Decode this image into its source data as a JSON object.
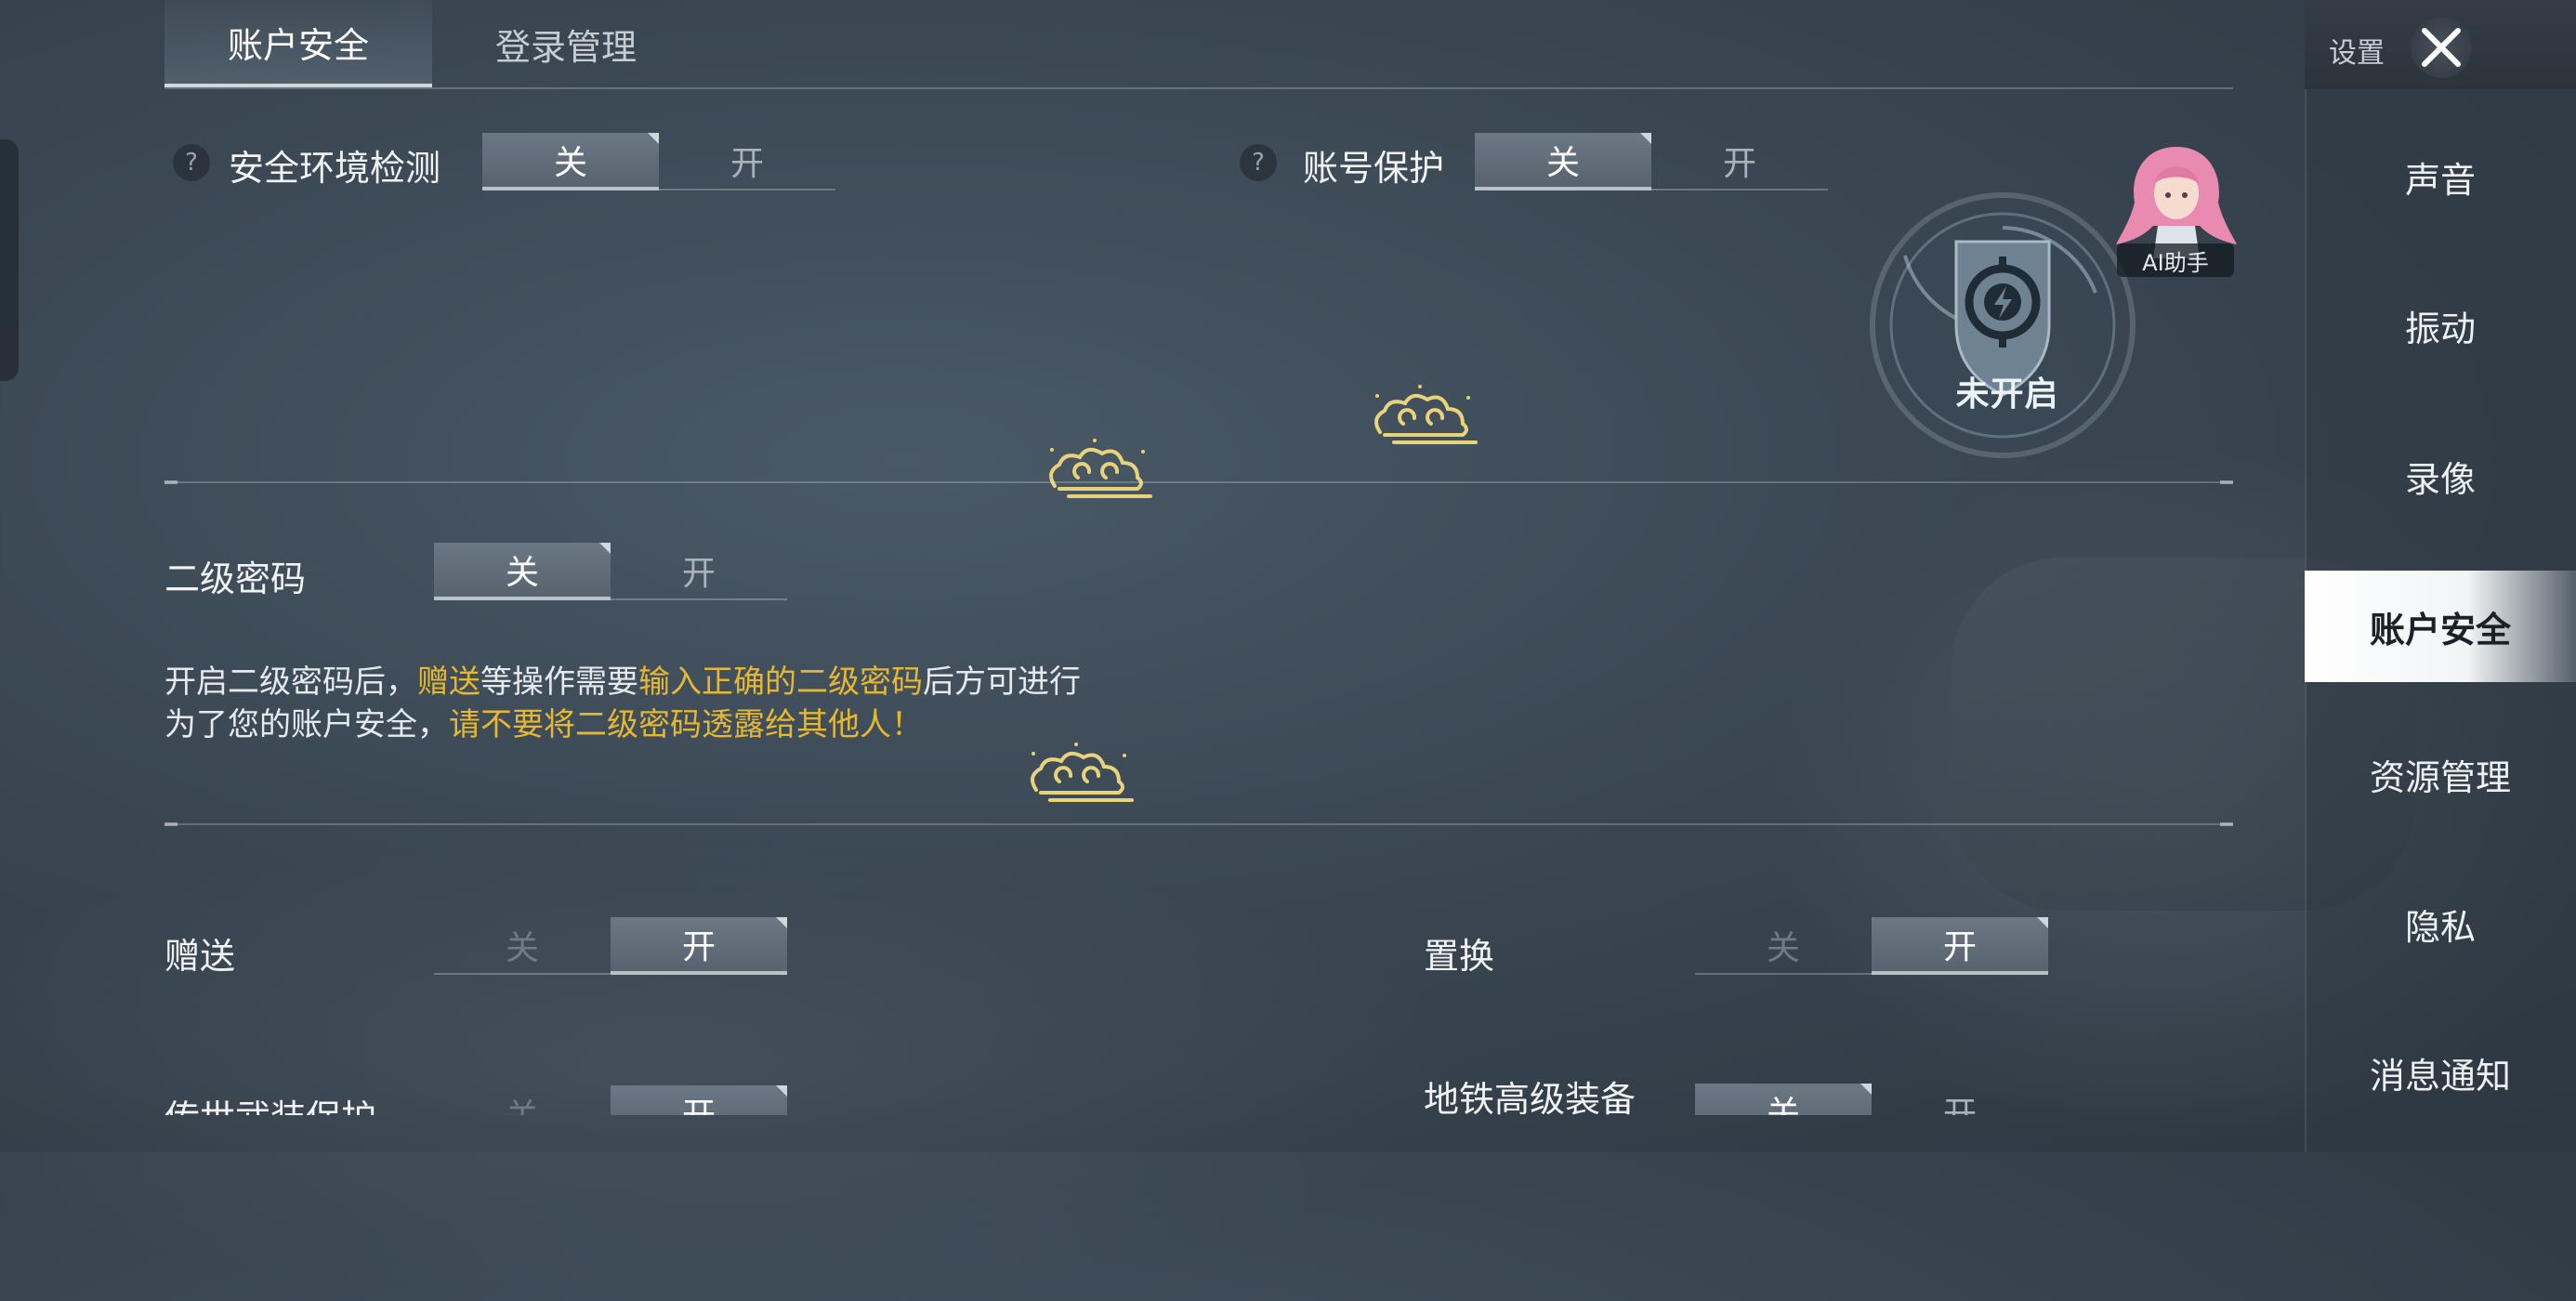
{
  "tabs": [
    {
      "label": "账户安全",
      "active": true
    },
    {
      "label": "登录管理",
      "active": false
    }
  ],
  "security_check": {
    "help": "?",
    "label": "安全环境检测",
    "off": "关",
    "on": "开",
    "value": "关"
  },
  "account_protect": {
    "help": "?",
    "label": "账号保护",
    "off": "关",
    "on": "开",
    "value": "关"
  },
  "secondary_password": {
    "label": "二级密码",
    "off": "关",
    "on": "开",
    "value": "关",
    "desc_line1": [
      {
        "text": "开启二级密码后，",
        "highlight": false
      },
      {
        "text": "赠送",
        "highlight": true
      },
      {
        "text": "等操作需要",
        "highlight": false
      },
      {
        "text": "输入正确的二级密码",
        "highlight": true
      },
      {
        "text": "后方可进行",
        "highlight": false
      }
    ],
    "desc_line2": [
      {
        "text": "为了您的账户安全，",
        "highlight": false
      },
      {
        "text": "请不要将二级密码透露给其他人！",
        "highlight": true
      }
    ]
  },
  "gift": {
    "label": "赠送",
    "off": "关",
    "on": "开",
    "value": "开"
  },
  "exchange": {
    "label": "置换",
    "off": "关",
    "on": "开",
    "value": "开"
  },
  "legendary_protect": {
    "label": "传世武装保护",
    "off": "关",
    "on": "开",
    "value": "开"
  },
  "metro_equipment": {
    "label": "地铁高级装备",
    "off": "关",
    "on": "开",
    "value": "关"
  },
  "shield_badge": {
    "status": "未开启"
  },
  "ai_assistant": {
    "label": "AI助手"
  },
  "header": {
    "settings_label": "设置"
  },
  "sidebar": {
    "items": [
      {
        "label": "声音",
        "active": false
      },
      {
        "label": "振动",
        "active": false
      },
      {
        "label": "录像",
        "active": false
      },
      {
        "label": "账户安全",
        "active": true
      },
      {
        "label": "资源管理",
        "active": false
      },
      {
        "label": "隐私",
        "active": false
      },
      {
        "label": "消息通知",
        "active": false
      }
    ]
  },
  "colors": {
    "highlight": "#e5b732",
    "accent": "#6b7784",
    "sidebar_active": "#ffffff"
  }
}
